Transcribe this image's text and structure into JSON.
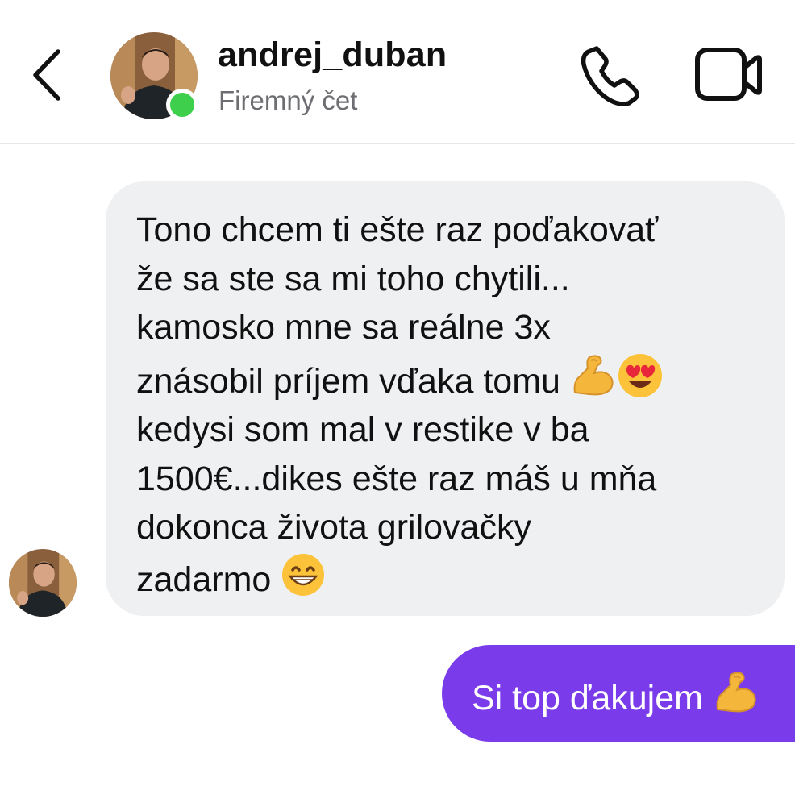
{
  "header": {
    "username": "andrej_duban",
    "subtitle": "Firemný čet",
    "online": true
  },
  "icons": {
    "back": "chevron-left-icon",
    "call": "phone-icon",
    "video": "video-camera-icon",
    "flexed_biceps": "flexed-biceps-emoji",
    "heart_eyes": "heart-eyes-emoji",
    "grin": "grinning-face-emoji"
  },
  "colors": {
    "outgoing_bubble": "#7a3bea",
    "incoming_bubble": "#eff0f2",
    "online_dot": "#3ecf4d",
    "subtitle": "#6d6e72"
  },
  "messages": {
    "incoming": {
      "line1": "Tono chcem ti ešte raz poďakovať",
      "line2": "že sa ste sa mi toho chytili...",
      "line3": "kamosko mne sa reálne 3x",
      "line4": "znásobil príjem vďaka tomu",
      "line5": "kedysi som mal v restike v ba",
      "line6": "1500€...dikes ešte raz máš u mňa",
      "line7": "dokonca života grilovačky",
      "line8": "zadarmo"
    },
    "outgoing": {
      "text": "Si top ďakujem"
    }
  }
}
